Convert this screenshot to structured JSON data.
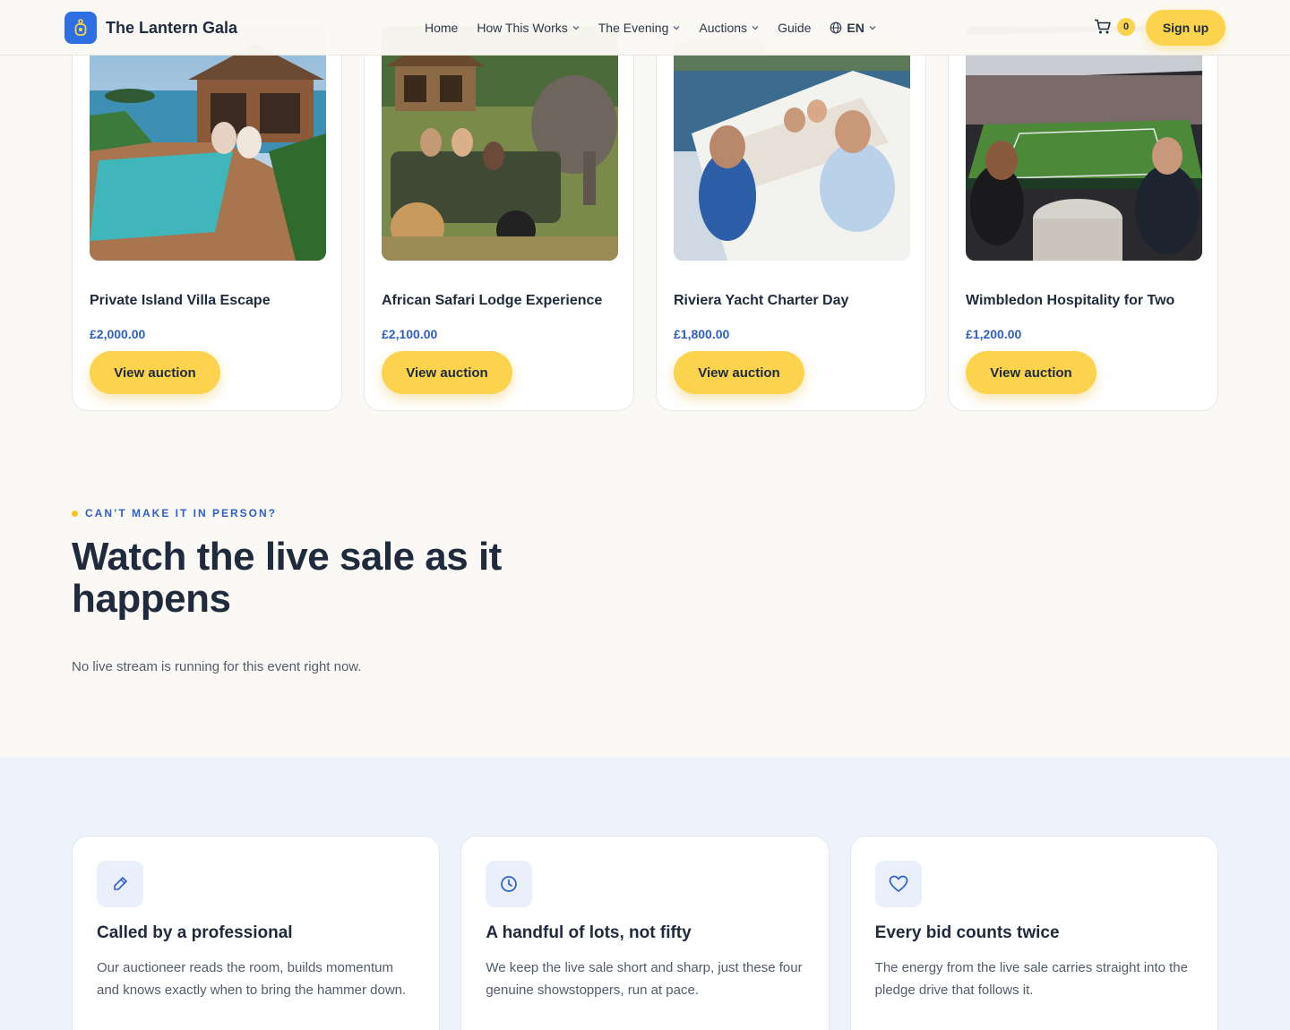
{
  "nav": {
    "brand": "The Lantern Gala",
    "items": [
      {
        "label": "Home",
        "dropdown": false
      },
      {
        "label": "How This Works",
        "dropdown": true
      },
      {
        "label": "The Evening",
        "dropdown": true
      },
      {
        "label": "Auctions",
        "dropdown": true
      },
      {
        "label": "Guide",
        "dropdown": false
      }
    ],
    "language": "EN",
    "cart_count": "0",
    "signup_label": "Sign up"
  },
  "lots": [
    {
      "title": "Private Island Villa Escape",
      "price": "£2,000.00",
      "button": "View auction",
      "image": "villa-pool-photo"
    },
    {
      "title": "African Safari Lodge Experience",
      "price": "£2,100.00",
      "button": "View auction",
      "image": "safari-jeep-photo"
    },
    {
      "title": "Riviera Yacht Charter Day",
      "price": "£1,800.00",
      "button": "View auction",
      "image": "yacht-deck-photo"
    },
    {
      "title": "Wimbledon Hospitality for Two",
      "price": "£1,200.00",
      "button": "View auction",
      "image": "tennis-box-photo"
    }
  ],
  "live": {
    "eyebrow": "CAN’T MAKE IT IN PERSON?",
    "title": "Watch the live sale as it happens",
    "note": "No live stream is running for this event right now."
  },
  "features": [
    {
      "icon": "pen-icon",
      "title": "Called by a professional",
      "body": "Our auctioneer reads the room, builds momentum and knows exactly when to bring the hammer down."
    },
    {
      "icon": "clock-icon",
      "title": "A handful of lots, not fifty",
      "body": "We keep the live sale short and sharp, just these four genuine showstoppers, run at pace."
    },
    {
      "icon": "heart-icon",
      "title": "Every bid counts twice",
      "body": "The energy from the live sale carries straight into the pledge drive that follows it."
    }
  ],
  "colors": {
    "accent": "#fcd34d",
    "brand_blue": "#2f6fe4",
    "price_blue": "#2f5fc4",
    "feature_bg": "#eef2fa"
  }
}
